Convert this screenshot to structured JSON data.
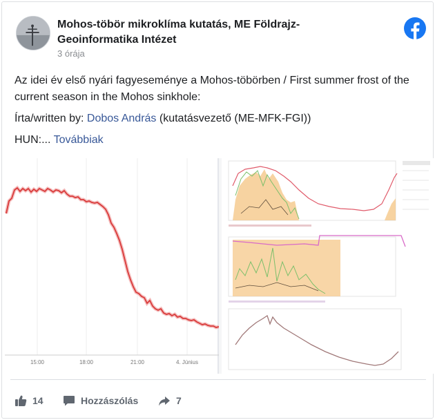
{
  "post": {
    "page_name": "Mohos-töbör mikroklíma kutatás, ME Földrajz-Geoinformatika Intézet",
    "timestamp": "3 órája",
    "text_line1": "Az idei év első nyári fagyeseménye a Mohos-töbörben / First summer frost of the current season in the Mohos sinkhole:",
    "written_prefix": "Írta/written by: ",
    "author": "Dobos András",
    "written_suffix": " (kutatásvezető (ME-MFK-FGI))",
    "hun_prefix": "HUN:... ",
    "more_link": "Továbbiak"
  },
  "chart_left": {
    "x_tick_labels": [
      "15:00",
      "18:00",
      "21:00",
      "4. Június"
    ]
  },
  "footer": {
    "like_count": "14",
    "comment_label": "Hozzászólás",
    "share_count": "7"
  },
  "colors": {
    "facebook_blue": "#1877f2",
    "link": "#385898",
    "temperature_line": "#d93a3a"
  }
}
